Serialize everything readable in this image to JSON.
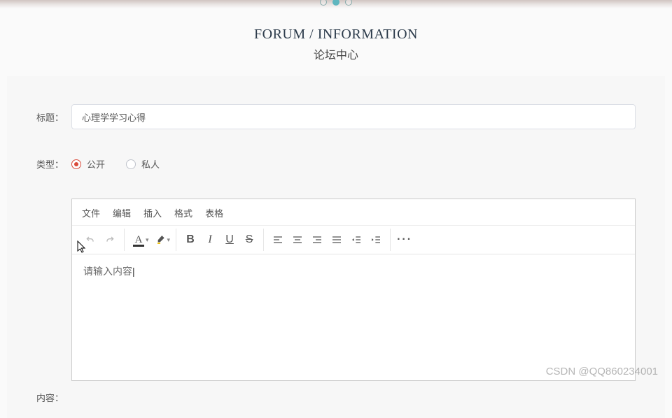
{
  "header": {
    "title_en": "FORUM / INFORMATION",
    "title_cn": "论坛中心"
  },
  "form": {
    "title_label": "标题：",
    "title_value": "心理学学习心得",
    "type_label": "类型：",
    "radio_public": "公开",
    "radio_private": "私人",
    "content_label": "内容："
  },
  "editor": {
    "menu": {
      "file": "文件",
      "edit": "编辑",
      "insert": "插入",
      "format": "格式",
      "table": "表格"
    },
    "placeholder": "请输入内容"
  },
  "watermark": "CSDN @QQ860234001",
  "colors": {
    "accent": "#d94a3a",
    "text_color": "#333333",
    "highlight": "#f1c40f"
  }
}
